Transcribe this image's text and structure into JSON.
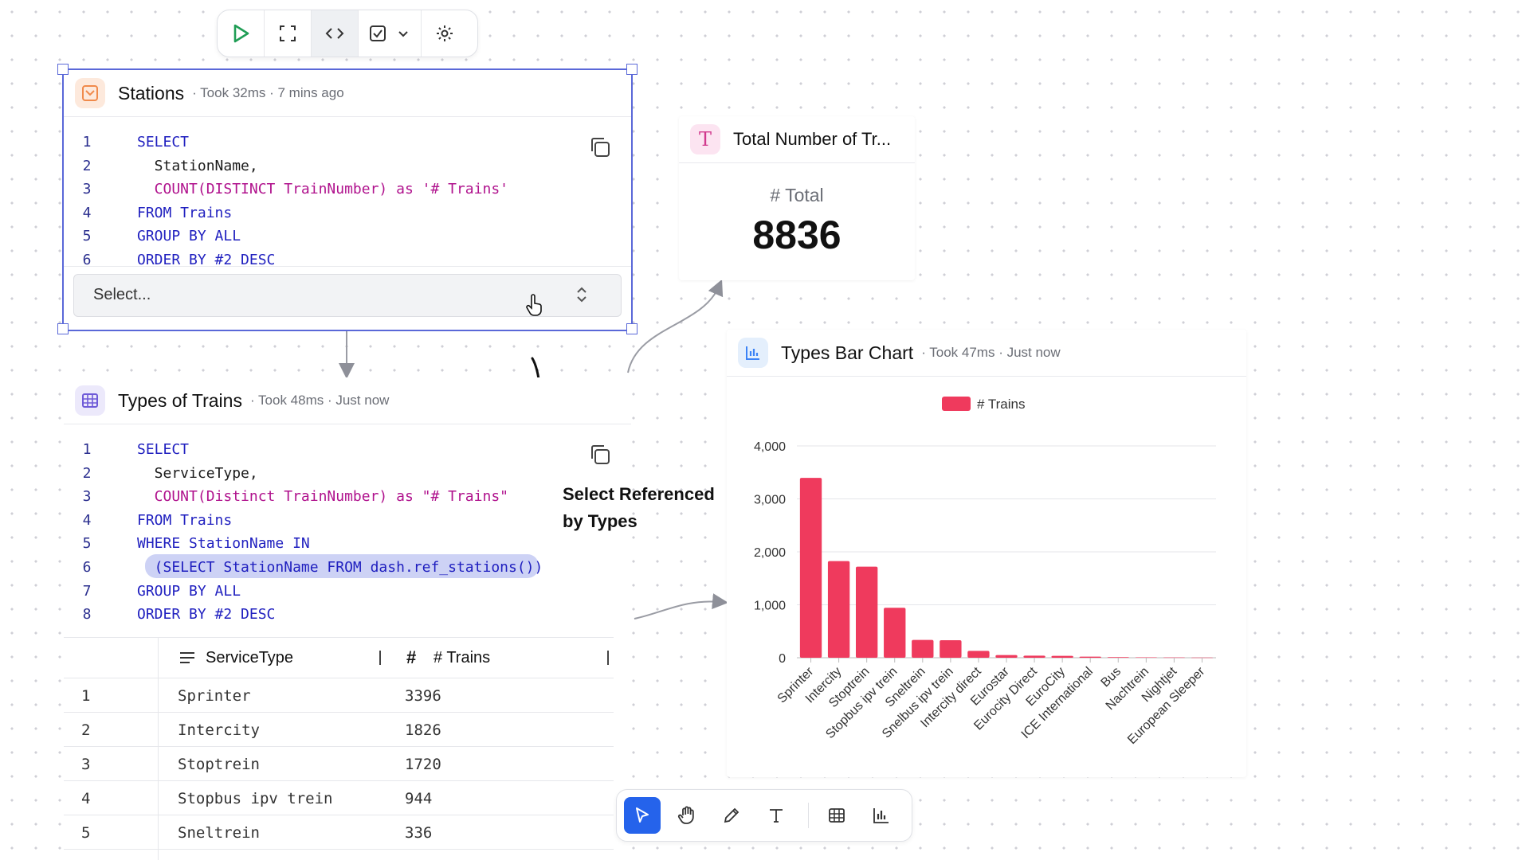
{
  "toolbar": {
    "icons": [
      "play-icon",
      "expand-icon",
      "code-icon",
      "checkbox-icon",
      "chevron-down-icon",
      "gear-icon"
    ]
  },
  "stations_panel": {
    "title": "Stations",
    "meta": "· Took 32ms · 7 mins ago",
    "code": [
      {
        "n": "1",
        "text": "SELECT"
      },
      {
        "n": "2",
        "text": "  StationName,"
      },
      {
        "n": "3",
        "text": "  COUNT(DISTINCT TrainNumber) as '# Trains'"
      },
      {
        "n": "4",
        "text": "FROM Trains"
      },
      {
        "n": "5",
        "text": "GROUP BY ALL"
      },
      {
        "n": "6",
        "text": "ORDER BY #2 DESC"
      }
    ],
    "select": {
      "placeholder": "Select..."
    }
  },
  "types_panel": {
    "title": "Types of Trains",
    "meta": "· Took 48ms · Just now",
    "code": [
      {
        "n": "1",
        "text": "SELECT"
      },
      {
        "n": "2",
        "text": "  ServiceType,"
      },
      {
        "n": "3",
        "text": "  COUNT(Distinct TrainNumber) as \"# Trains\""
      },
      {
        "n": "4",
        "text": "FROM Trains"
      },
      {
        "n": "5",
        "text": "WHERE StationName IN"
      },
      {
        "n": "6",
        "text": "  (SELECT StationName FROM dash.ref_stations())"
      },
      {
        "n": "7",
        "text": "GROUP BY ALL"
      },
      {
        "n": "8",
        "text": "ORDER BY #2 DESC"
      }
    ],
    "table": {
      "headers": [
        "ServiceType",
        "# Trains"
      ],
      "rows": [
        [
          "1",
          "Sprinter",
          "3396"
        ],
        [
          "2",
          "Intercity",
          "1826"
        ],
        [
          "3",
          "Stoptrein",
          "1720"
        ],
        [
          "4",
          "Stopbus ipv trein",
          "944"
        ],
        [
          "5",
          "Sneltrein",
          "336"
        ]
      ]
    }
  },
  "total_panel": {
    "title": "Total Number of Tr...",
    "label": "# Total",
    "value": "8836"
  },
  "annotation": {
    "line1": "Select Referenced",
    "line2": "by Types"
  },
  "chart_panel": {
    "title": "Types Bar Chart",
    "meta": "· Took 47ms · Just now"
  },
  "colors": {
    "bar": "#ef3a5d",
    "selection": "#5a68d8",
    "play": "#1f9d55"
  },
  "chart_data": {
    "type": "bar",
    "categories": [
      "Sprinter",
      "Intercity",
      "Stoptrein",
      "Stopbus ipv trein",
      "Sneltrein",
      "Snelbus ipv trein",
      "Intercity direct",
      "Eurostar",
      "Eurocity Direct",
      "EuroCity",
      "ICE International",
      "Bus",
      "Nachtrein",
      "Nightjet",
      "European Sleeper"
    ],
    "series": [
      {
        "name": "# Trains",
        "values": [
          3396,
          1826,
          1720,
          944,
          336,
          330,
          130,
          50,
          40,
          35,
          20,
          12,
          8,
          5,
          3
        ]
      }
    ],
    "ylim": [
      0,
      4000
    ],
    "yticks": [
      0,
      1000,
      2000,
      3000,
      4000
    ],
    "ytick_labels": [
      "0",
      "1,000",
      "2,000",
      "3,000",
      "4,000"
    ],
    "grid": true,
    "legend": "top-center"
  }
}
